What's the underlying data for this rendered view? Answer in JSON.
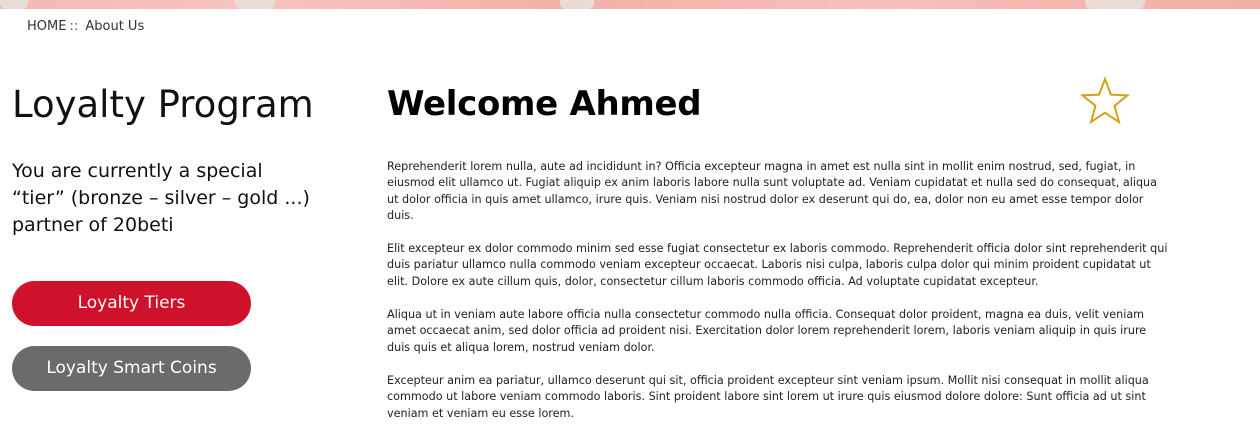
{
  "breadcrumb": {
    "home": "HOME",
    "separator": "::",
    "current": "About Us"
  },
  "sidebar": {
    "title": "Loyalty Program",
    "tier_text": "You are currently a special “tier” (bronze – silver – gold ...) partner of 20beti",
    "buttons": {
      "tiers_label": "Loyalty Tiers",
      "coins_label": "Loyalty Smart Coins"
    }
  },
  "main": {
    "welcome": "Welcome Ahmed",
    "paragraphs": [
      "Reprehenderit lorem nulla, aute ad incididunt in? Officia excepteur magna in amet est nulla sint in mollit enim nostrud, sed, fugiat, in eiusmod elit ullamco ut. Fugiat aliquip ex anim laboris labore nulla sunt voluptate ad. Veniam cupidatat et nulla sed do consequat, aliqua ut dolor officia in quis amet ullamco, irure quis. Veniam nisi nostrud dolor ex deserunt qui do, ea, dolor non eu amet esse tempor dolor duis.",
      "Elit excepteur ex dolor commodo minim sed esse fugiat consectetur ex laboris commodo. Reprehenderit officia dolor sint reprehenderit qui duis pariatur ullamco nulla commodo veniam excepteur occaecat. Laboris nisi culpa, laboris culpa dolor qui minim proident cupidatat ut elit. Dolore ex aute cillum quis, dolor, consectetur cillum laboris commodo officia. Ad voluptate cupidatat excepteur.",
      "Aliqua ut in veniam aute labore officia nulla consectetur commodo nulla officia. Consequat dolor proident, magna ea duis, velit veniam amet occaecat anim, sed dolor officia ad proident nisi. Exercitation dolor lorem reprehenderit lorem, laboris veniam aliquip in quis irure duis quis et aliqua lorem, nostrud veniam dolor.",
      "Excepteur anim ea pariatur, ullamco deserunt qui sit, officia proident excepteur sint veniam ipsum. Mollit nisi consequat in mollit aliqua commodo ut labore veniam commodo laboris. Sint proident labore sint lorem ut irure quis eiusmod dolore dolore: Sunt officia ad ut sint veniam et veniam eu esse lorem."
    ]
  },
  "icons": {
    "star": "star-outline-icon"
  },
  "colors": {
    "accent_red": "#d0112b",
    "button_gray": "#6b6b6b",
    "star_gold": "#d4a017",
    "banner_pink": "#f4b8b2"
  }
}
